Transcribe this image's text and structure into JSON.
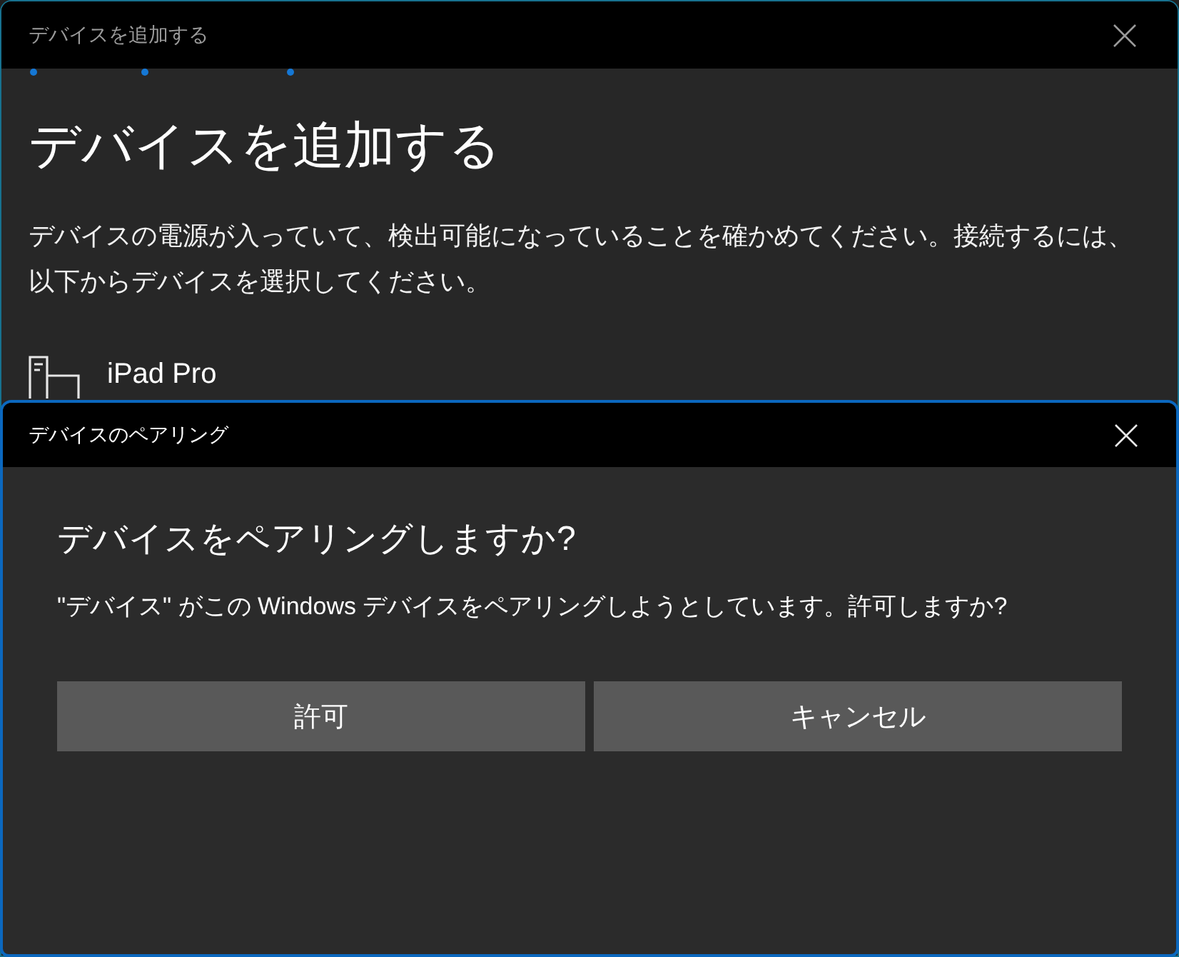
{
  "back_window": {
    "title": "デバイスを追加する",
    "heading": "デバイスを追加する",
    "description": "デバイスの電源が入っていて、検出可能になっていることを確かめてください。接続するには、以下からデバイスを選択してください。",
    "devices": [
      {
        "name": "iPad Pro"
      }
    ]
  },
  "dialog": {
    "title": "デバイスのペアリング",
    "heading": "デバイスをペアリングしますか?",
    "message": "\"デバイス\" がこの Windows デバイスをペアリングしようとしています。許可しますか?",
    "buttons": [
      {
        "label": "許可"
      },
      {
        "label": "キャンセル"
      }
    ]
  }
}
